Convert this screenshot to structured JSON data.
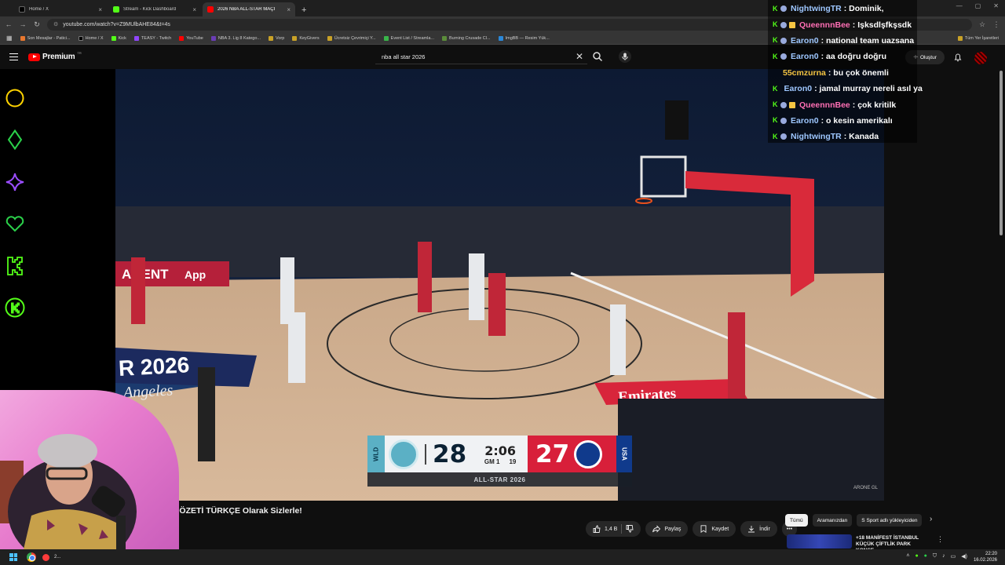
{
  "browser": {
    "tabs": [
      {
        "label": "Home / X",
        "favicon_color": "#000000",
        "active": false
      },
      {
        "label": "Stream - Kick Dashboard",
        "favicon_color": "#53fc18",
        "active": false
      },
      {
        "label": "2026 NBA ALL-STAR MAÇI",
        "favicon_color": "#ff0000",
        "active": true
      }
    ],
    "new_tab": "+",
    "url": "youtube.com/watch?v=Z9MUlbAHE84&t=4s",
    "bookmarks": [
      {
        "label": "Son Mesajlar - Patici...",
        "color": "#e8772e"
      },
      {
        "label": "Home / X",
        "color": "#000000"
      },
      {
        "label": "Kick",
        "color": "#53fc18"
      },
      {
        "label": "TEASY - Twitch",
        "color": "#9146ff"
      },
      {
        "label": "YouTube",
        "color": "#ff0000"
      },
      {
        "label": "NBA 3. Lig 8 Katego...",
        "color": "#6a3db5"
      },
      {
        "label": "Vorp",
        "color": "#c9a227"
      },
      {
        "label": "KeyGivers",
        "color": "#c9a227"
      },
      {
        "label": "Ücretsiz Çevrimiçi Y...",
        "color": "#c9a227"
      },
      {
        "label": "Event List / Streamla...",
        "color": "#39b54a"
      },
      {
        "label": "Burning Crusade Cl...",
        "color": "#5b8c3a"
      },
      {
        "label": "ImgBB — Resim Yük...",
        "color": "#2b88d8"
      }
    ],
    "all_bookmarks": "Tüm Yer İşaretleri"
  },
  "youtube": {
    "logo_text": "Premium",
    "logo_country": "TR",
    "search_value": "nba all star 2026",
    "create_label": "Oluştur",
    "video_title": "IN ÖZETİ TÜRKÇE Olarak Sizlerle!",
    "actions": {
      "likes": "1,4 B",
      "share": "Paylaş",
      "save": "Kaydet",
      "download": "İndir"
    },
    "chips": [
      "Tümü",
      "Aramanızdan",
      "S Sport adlı yükleyiciden"
    ],
    "recommended_title": "+18 MANİFEST İSTANBUL KÜÇÜK ÇİFTLİK PARK KONSE...",
    "watermark": "ARONE GL"
  },
  "scoreboard": {
    "team_left": "WLD",
    "score_left": "28",
    "clock": "2:06",
    "game": "GM 1",
    "shot_clock": "19",
    "score_right": "27",
    "team_right": "USA",
    "footer": "ALL-STAR 2026"
  },
  "court_text": {
    "arena_banner": "R 2026",
    "sub_banner": "Angeles",
    "sponsor": "Emirates",
    "board": "AGENT",
    "app": "App"
  },
  "chat": [
    {
      "user": "NightwingTR",
      "msg": "Dominik,",
      "color": "#9ec7ff",
      "badge": "plain"
    },
    {
      "user": "QueennnBee",
      "msg": "Işksdlşfkşsdk",
      "color": "#ff6fb4",
      "badge": "sub"
    },
    {
      "user": "Earon0",
      "msg": "national team uazsana",
      "color": "#9ec7ff",
      "badge": "plain"
    },
    {
      "user": "Earon0",
      "msg": "aa doğru doğru",
      "color": "#9ec7ff",
      "badge": "plain"
    },
    {
      "user": "55cmzurna",
      "msg": "bu çok önemli",
      "color": "#f5c542",
      "badge": "none"
    },
    {
      "user": "Earon0",
      "msg": "jamal murray nereli asıl ya",
      "color": "#9ec7ff",
      "badge": "plain"
    },
    {
      "user": "QueennnBee",
      "msg": "çok kritilk",
      "color": "#ff6fb4",
      "badge": "sub"
    },
    {
      "user": "Earon0",
      "msg": "o kesin amerikalı",
      "color": "#9ec7ff",
      "badge": "plain"
    },
    {
      "user": "NightwingTR",
      "msg": "Kanada",
      "color": "#9ec7ff",
      "badge": "plain"
    }
  ],
  "taskbar": {
    "app_label": "2...",
    "time": "22:20",
    "date": "16.02.2026"
  },
  "rail_icons": [
    {
      "name": "circle-icon",
      "color": "#ffd400"
    },
    {
      "name": "diamond-icon",
      "color": "#2bd14a"
    },
    {
      "name": "star-icon",
      "color": "#9b4dff"
    },
    {
      "name": "heart-icon",
      "color": "#2bd14a"
    },
    {
      "name": "kick-icon",
      "color": "#53fc18"
    },
    {
      "name": "kick-badge-icon",
      "color": "#53fc18"
    }
  ]
}
